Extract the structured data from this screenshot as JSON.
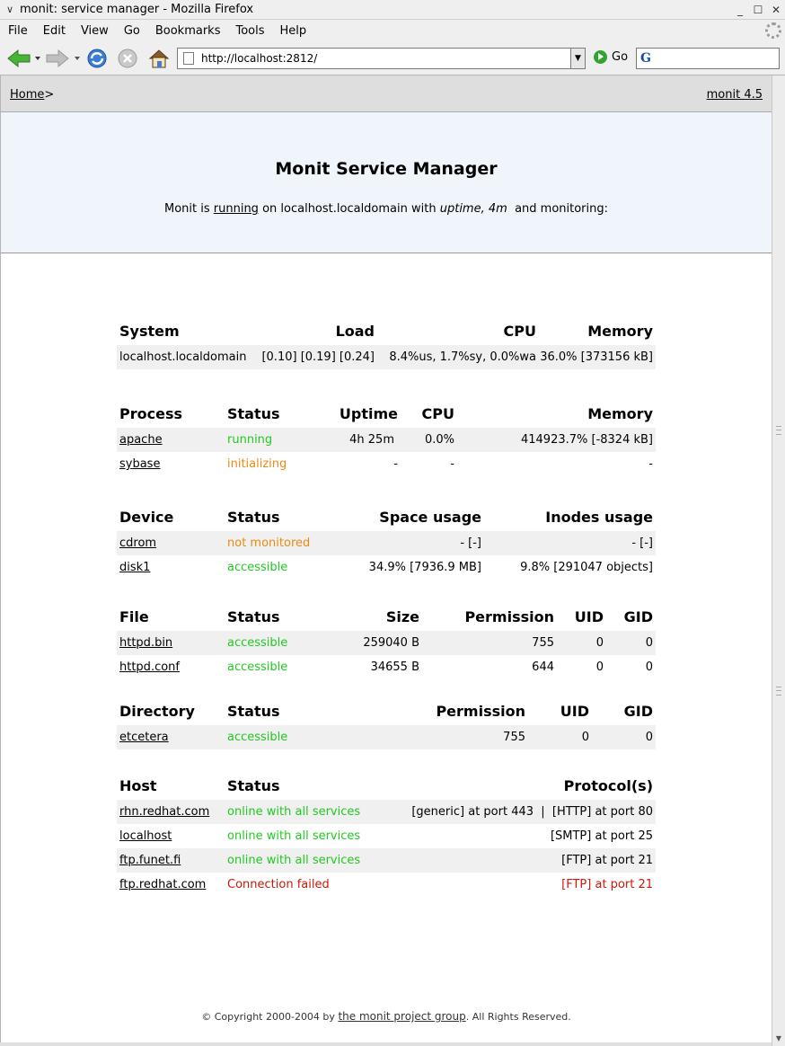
{
  "window": {
    "title": "monit: service manager - Mozilla Firefox"
  },
  "menubar": {
    "items": [
      "File",
      "Edit",
      "View",
      "Go",
      "Bookmarks",
      "Tools",
      "Help"
    ]
  },
  "toolbar": {
    "url": "http://localhost:2812/",
    "go_label": "Go",
    "search_value": ""
  },
  "header": {
    "home_label": "Home",
    "home_sep": ">",
    "version": "monit 4.5"
  },
  "hero": {
    "title": "Monit Service Manager",
    "prefix": "Monit is",
    "running": "running",
    "host_text": "on localhost.localdomain with",
    "uptime_label": "uptime, 4m",
    "suffix": "and monitoring:"
  },
  "system": {
    "headers": [
      "System",
      "Load",
      "CPU",
      "Memory"
    ],
    "row": {
      "name": "localhost.localdomain",
      "load": "[0.10] [0.19] [0.24]",
      "cpu": "8.4%us, 1.7%sy, 0.0%wa",
      "memory": "36.0% [373156 kB]"
    }
  },
  "process": {
    "headers": [
      "Process",
      "Status",
      "Uptime",
      "CPU",
      "Memory"
    ],
    "rows": [
      {
        "name": "apache",
        "status": "running",
        "uptime": "4h 25m",
        "cpu": "0.0%",
        "memory": "414923.7% [-8324 kB]"
      },
      {
        "name": "sybase",
        "status": "initializing",
        "uptime": "-",
        "cpu": "-",
        "memory": "-"
      }
    ]
  },
  "device": {
    "headers": [
      "Device",
      "Status",
      "Space usage",
      "Inodes usage"
    ],
    "rows": [
      {
        "name": "cdrom",
        "status": "not monitored",
        "space": "- [-]",
        "inodes": "- [-]"
      },
      {
        "name": "disk1",
        "status": "accessible",
        "space": "34.9% [7936.9 MB]",
        "inodes": "9.8% [291047 objects]"
      }
    ]
  },
  "file": {
    "headers": [
      "File",
      "Status",
      "Size",
      "Permission",
      "UID",
      "GID"
    ],
    "rows": [
      {
        "name": "httpd.bin",
        "status": "accessible",
        "size": "259040 B",
        "perm": "755",
        "uid": "0",
        "gid": "0"
      },
      {
        "name": "httpd.conf",
        "status": "accessible",
        "size": "34655 B",
        "perm": "644",
        "uid": "0",
        "gid": "0"
      }
    ]
  },
  "directory": {
    "headers": [
      "Directory",
      "Status",
      "Permission",
      "UID",
      "GID"
    ],
    "rows": [
      {
        "name": "etcetera",
        "status": "accessible",
        "perm": "755",
        "uid": "0",
        "gid": "0"
      }
    ]
  },
  "host": {
    "headers": [
      "Host",
      "Status",
      "Protocol(s)"
    ],
    "rows": [
      {
        "name": "rhn.redhat.com",
        "status": "online with all services",
        "protocols": "[generic] at port 443  |  [HTTP] at port 80"
      },
      {
        "name": "localhost",
        "status": "online with all services",
        "protocols": "[SMTP] at port 25"
      },
      {
        "name": "ftp.funet.fi",
        "status": "online with all services",
        "protocols": "[FTP] at port 21"
      },
      {
        "name": "ftp.redhat.com",
        "status": "Connection failed",
        "protocols": "[FTP] at port 21"
      }
    ]
  },
  "footer": {
    "prefix": "© Copyright 2000-2004 by",
    "link": "the monit project group",
    "suffix": ". All Rights Reserved."
  },
  "colors": {
    "ok": "#22c922",
    "warn": "#e88a14",
    "error": "#c81a0a",
    "hero_bg": "#f0f5fb",
    "bar_bg": "#dedede"
  }
}
